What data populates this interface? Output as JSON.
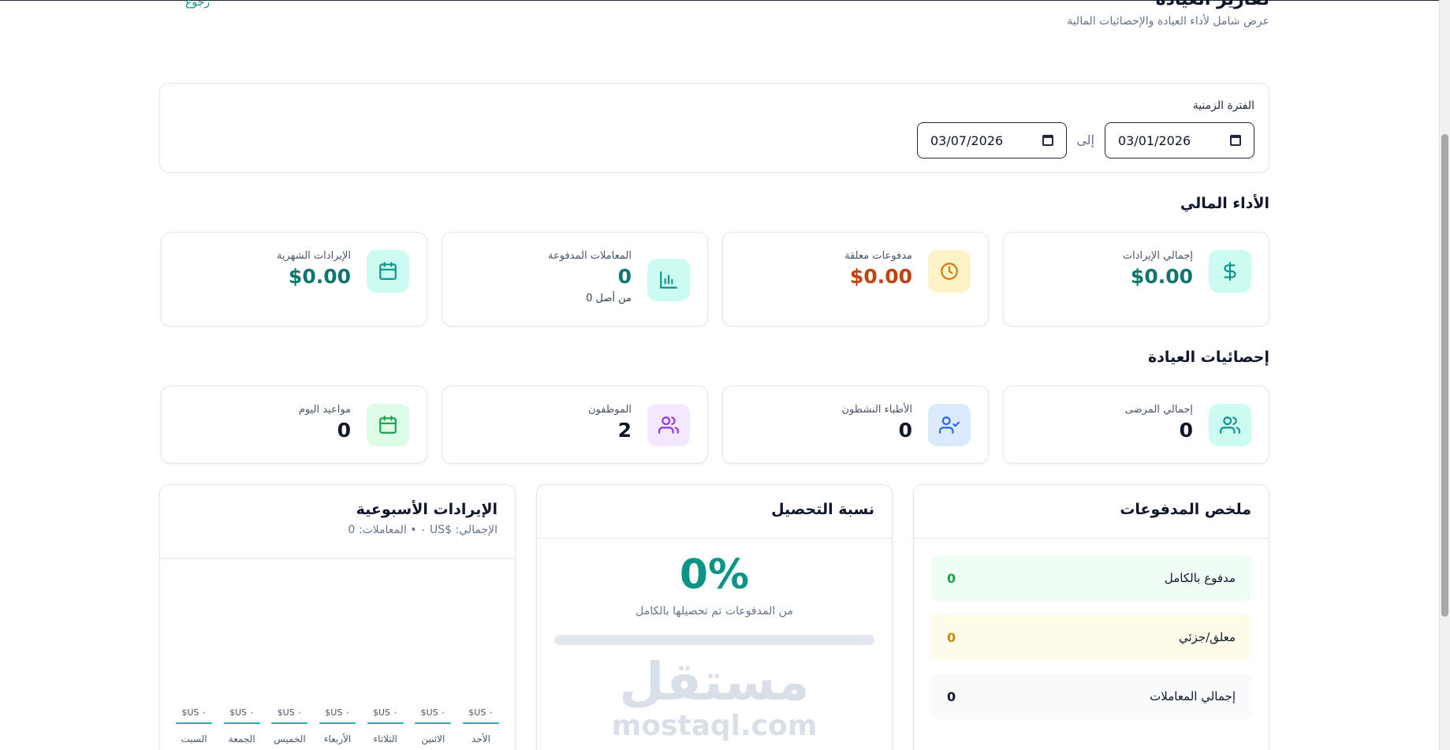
{
  "header": {
    "title": "تقارير العيادة",
    "subtitle": "عرض شامل لأداء العيادة والإحصائيات المالية",
    "back_label": "رجوع"
  },
  "period": {
    "label": "الفترة الزمنية",
    "from_value": "03/01/2026",
    "to_label": "إلى",
    "to_value": "03/07/2026"
  },
  "financial": {
    "title": "الأداء المالي",
    "cards": [
      {
        "label": "إجمالي الإيرادات",
        "value": "$0.00",
        "icon": "dollar-icon",
        "icon_bg": "#ccfbf1",
        "icon_color": "#0d9488",
        "value_color": "#0f766e"
      },
      {
        "label": "مدفوعات معلقة",
        "value": "$0.00",
        "icon": "clock-icon",
        "icon_bg": "#fef3c7",
        "icon_color": "#d97706",
        "value_color": "#c2410c"
      },
      {
        "label": "المعاملات المدفوعة",
        "value": "0",
        "note": "من أصل 0",
        "icon": "bar-chart-icon",
        "icon_bg": "#ccfbf1",
        "icon_color": "#0d9488",
        "value_color": "#0f766e"
      },
      {
        "label": "الإيرادات الشهرية",
        "value": "$0.00",
        "icon": "calendar-icon",
        "icon_bg": "#ccfbf1",
        "icon_color": "#0d9488",
        "value_color": "#0f766e"
      }
    ]
  },
  "clinic": {
    "title": "إحصائيات العيادة",
    "cards": [
      {
        "label": "إجمالي المرضى",
        "value": "0",
        "icon": "users-icon",
        "icon_bg": "#ccfbf1",
        "icon_color": "#0d9488",
        "value_color": "#0f172a"
      },
      {
        "label": "الأطباء النشطون",
        "value": "0",
        "icon": "user-check-icon",
        "icon_bg": "#dbeafe",
        "icon_color": "#2563eb",
        "value_color": "#0f172a"
      },
      {
        "label": "الموظفون",
        "value": "2",
        "icon": "users-icon",
        "icon_bg": "#f3e8ff",
        "icon_color": "#9333ea",
        "value_color": "#0f172a"
      },
      {
        "label": "مواعيد اليوم",
        "value": "0",
        "icon": "calendar-icon",
        "icon_bg": "#dcfce7",
        "icon_color": "#16a34a",
        "value_color": "#0f172a"
      }
    ]
  },
  "payments_summary": {
    "title": "ملخص المدفوعات",
    "rows": [
      {
        "label": "مدفوع بالكامل",
        "value": "0",
        "bg": "#f0fdf4",
        "color": "#16a34a"
      },
      {
        "label": "معلق/جزئي",
        "value": "0",
        "bg": "#fefce8",
        "color": "#ca8a04"
      },
      {
        "label": "إجمالي المعاملات",
        "value": "0",
        "bg": "#f8fafc",
        "color": "#0f172a"
      }
    ]
  },
  "collection": {
    "title": "نسبة التحصيل",
    "value": "0%",
    "percent": 0,
    "caption": "من المدفوعات تم تحصيلها بالكامل",
    "watermark_ar": "مستقل",
    "watermark_en": "mostaql.com"
  },
  "weekly": {
    "title": "الإيرادات الأسبوعية",
    "summary": "الإجمالي: $US ٠ • المعاملات: 0",
    "days": [
      {
        "name": "الأحد",
        "amount": "$US ٠"
      },
      {
        "name": "الاثنين",
        "amount": "$US ٠"
      },
      {
        "name": "الثلاثاء",
        "amount": "$US ٠"
      },
      {
        "name": "الأربعاء",
        "amount": "$US ٠"
      },
      {
        "name": "الخميس",
        "amount": "$US ٠"
      },
      {
        "name": "الجمعة",
        "amount": "$US ٠"
      },
      {
        "name": "السبت",
        "amount": "$US ٠"
      }
    ]
  }
}
